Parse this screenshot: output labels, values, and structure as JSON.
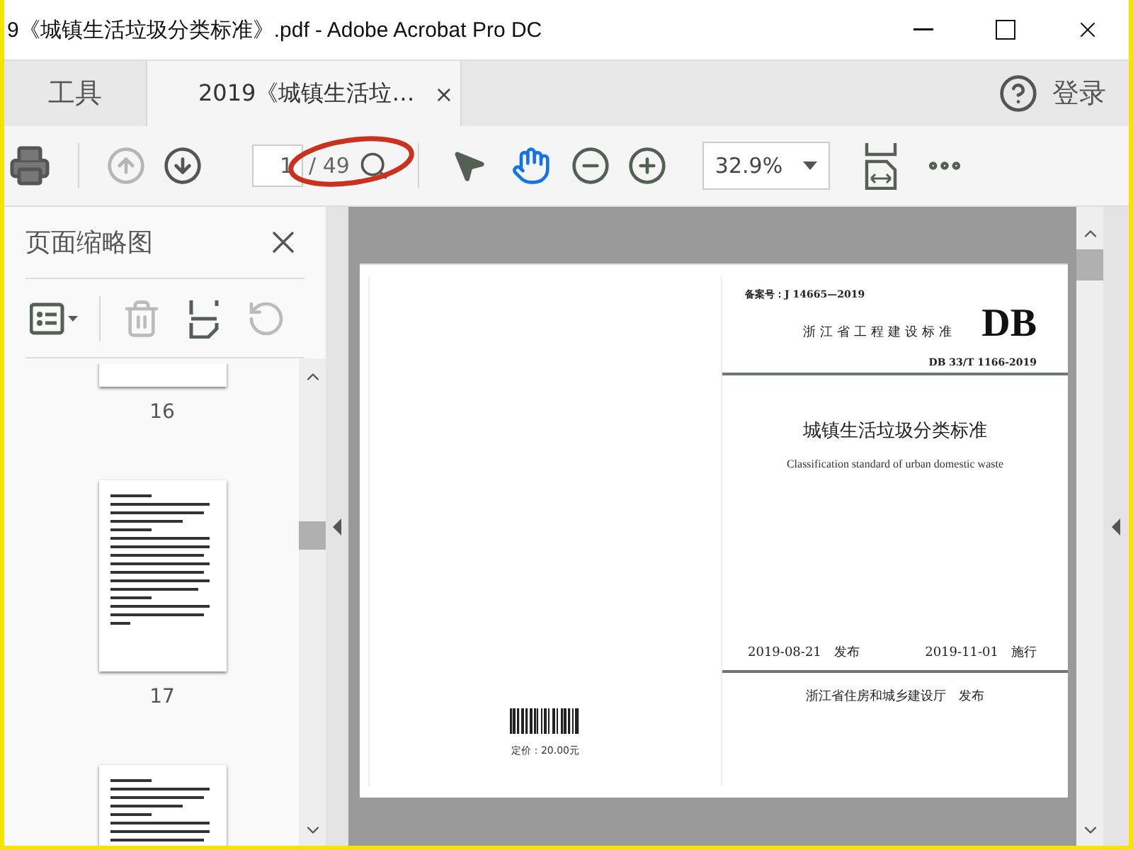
{
  "window": {
    "title": "9《城镇生活垃圾分类标准》.pdf - Adobe Acrobat Pro DC"
  },
  "tabs": [
    {
      "label": "工具",
      "selected": false
    },
    {
      "label": "2019《城镇生活垃…",
      "selected": true,
      "close": "×"
    }
  ],
  "header": {
    "signin": "登录"
  },
  "toolbar": {
    "nav": [
      {
        "kind": "prev",
        "disabled": true
      },
      {
        "kind": "next",
        "disabled": false
      }
    ],
    "page_field": "1",
    "page_total": "/ 49",
    "annotation": true,
    "tools": [
      {
        "kind": "select",
        "selected": false
      },
      {
        "kind": "hand",
        "selected": true
      }
    ],
    "zoom": "32.9%"
  },
  "sidebar": {
    "title": "页面缩略图",
    "actions": [
      {
        "kind": "options",
        "disabled": false
      },
      {
        "kind": "delete",
        "disabled": true
      },
      {
        "kind": "extract",
        "disabled": false
      },
      {
        "kind": "undo",
        "disabled": true
      }
    ],
    "thumbnails": [
      {
        "kind": "tail",
        "label": "16"
      },
      {
        "kind": "page",
        "label": "17"
      },
      {
        "kind": "page_cut"
      }
    ]
  },
  "document": {
    "left_page": {
      "price": "定价：20.00元"
    },
    "right_page": {
      "record": "备案号：J 14665—2019",
      "series": "浙江省工程建设标准",
      "mark": "DB",
      "code": "DB 33/T 1166-2019",
      "title": "城镇生活垃圾分类标准",
      "subtitle": "Classification standard of urban domestic waste",
      "issued": "2019-08-21　发布",
      "effective": "2019-11-01　施行",
      "issuer": "浙江省住房和城乡建设厅　发布"
    }
  }
}
